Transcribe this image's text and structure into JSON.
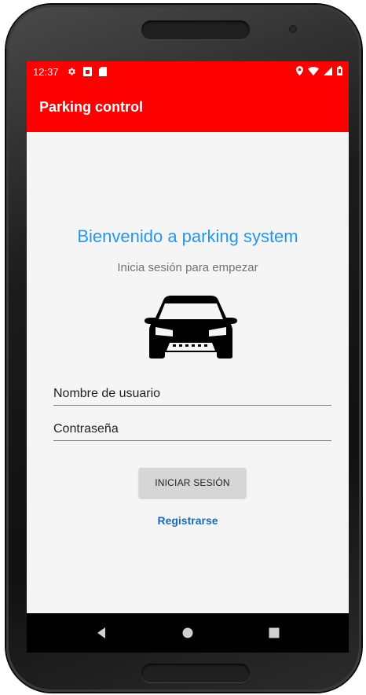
{
  "status_bar": {
    "time": "12:37",
    "left_icons": [
      "gear-icon",
      "sim-icon",
      "sd-card-icon"
    ],
    "right_icons": [
      "location-icon",
      "wifi-icon",
      "signal-icon",
      "battery-icon"
    ]
  },
  "app_bar": {
    "title": "Parking control"
  },
  "login": {
    "welcome_text": "Bienvenido a parking system",
    "subtitle": "Inicia sesión para empezar",
    "logo_icon": "car-icon",
    "username_placeholder": "Nombre de usuario",
    "password_placeholder": "Contraseña",
    "login_button": "INICIAR SESIÓN",
    "register_link": "Registrarse"
  },
  "nav_bar": {
    "buttons": [
      "back-icon",
      "home-icon",
      "recents-icon"
    ]
  },
  "colors": {
    "primary": "#fe0000",
    "accent_text": "#2296f3",
    "link": "#1a6bb3",
    "background": "#f5f5f5"
  }
}
